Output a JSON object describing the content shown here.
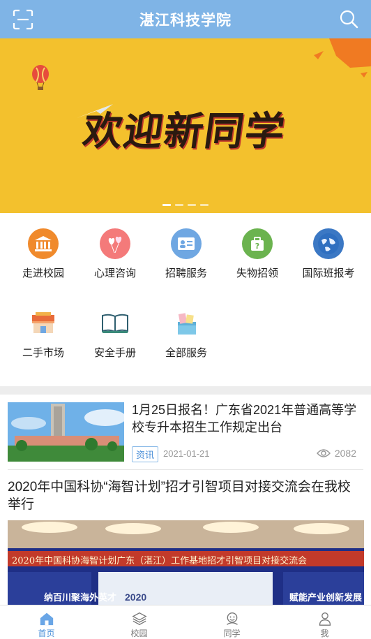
{
  "header": {
    "title": "湛江科技学院",
    "scan_icon": "scan-icon",
    "search_icon": "search-icon",
    "bg_color": "#7fb4e6"
  },
  "banner": {
    "text": "欢迎新同学",
    "slides": 4,
    "active_slide": 1,
    "bg_color": "#f3c12d"
  },
  "services": [
    {
      "label": "走进校园",
      "icon": "campus-building-icon",
      "color": "#f08a2c"
    },
    {
      "label": "心理咨询",
      "icon": "hearts-balloon-icon",
      "color": "#f47a7a"
    },
    {
      "label": "招聘服务",
      "icon": "recruit-id-card-icon",
      "color": "#6fa7e2"
    },
    {
      "label": "失物招领",
      "icon": "lost-found-icon",
      "color": "#6bb34f"
    },
    {
      "label": "国际班报考",
      "icon": "globe-icon",
      "color": "#3b78c4"
    },
    {
      "label": "二手市场",
      "icon": "market-stall-icon",
      "color": "#e86b3a"
    },
    {
      "label": "安全手册",
      "icon": "book-icon",
      "color": "#3a8a7a"
    },
    {
      "label": "全部服务",
      "icon": "gift-box-icon",
      "color": "#7ec8e8"
    }
  ],
  "news": [
    {
      "title": "1月25日报名！广东省2021年普通高等学校专升本招生工作规定出台",
      "tag": "资讯",
      "date": "2021-01-21",
      "views": "2082"
    },
    {
      "title": "2020年中国科协“海智计划”招才引智项目对接交流会在我校举行",
      "photo_banner_text": "2020年中国科协海智计划广东（湛江）工作基地招才引智项目对接交流会",
      "photo_left_text": "纳百川聚海外英才",
      "photo_right_text": "赋能产业创新发展",
      "photo_screen_year": "2020"
    }
  ],
  "tabbar": [
    {
      "label": "首页",
      "icon": "home-icon",
      "active": true
    },
    {
      "label": "校园",
      "icon": "layers-icon",
      "active": false
    },
    {
      "label": "同学",
      "icon": "classmates-icon",
      "active": false
    },
    {
      "label": "我",
      "icon": "user-icon",
      "active": false
    }
  ]
}
